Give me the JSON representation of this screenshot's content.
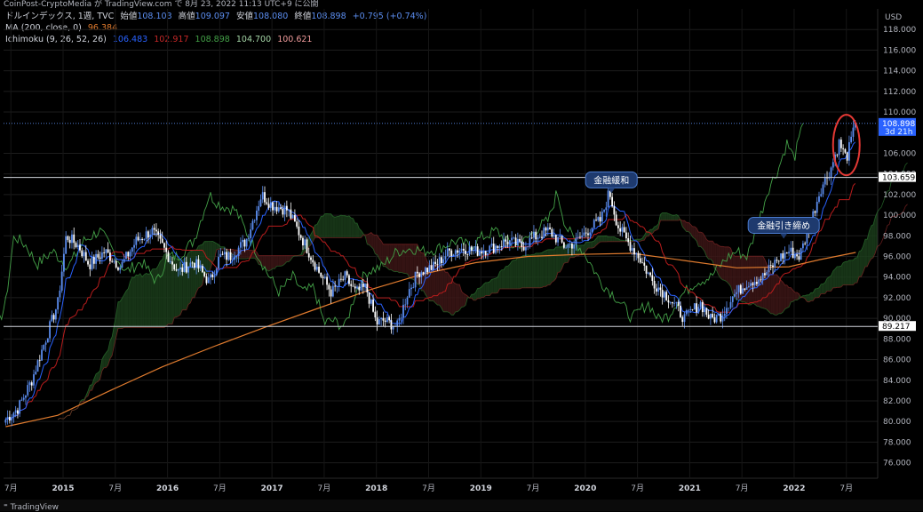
{
  "caption": "CoinPost-CryptoMedia が TradingView.com で 8月 23, 2022 11:13 UTC+9 に公開",
  "legend": {
    "line1": {
      "title": "ドルインデックス, 1週, TVC",
      "open_label": "始値",
      "open": "108.103",
      "high_label": "高値",
      "high": "109.097",
      "low_label": "安値",
      "low": "108.080",
      "close_label": "終値",
      "close": "108.898",
      "change": "+0.795 (+0.74%)"
    },
    "line2": {
      "label": "MA (200, close, 0)",
      "value": "96.384"
    },
    "line3": {
      "label": "Ichimoku (9, 26, 52, 26)",
      "v1": "106.483",
      "v2": "102.917",
      "v3": "108.898",
      "v4": "104.700",
      "v5": "100.621"
    }
  },
  "colors": {
    "candle_up": "#5b8def",
    "candle_down": "#ffffff",
    "conversion": "#2962ff",
    "base": "#b71c1c",
    "lagging": "#43a047",
    "ma200": "#e07b2e",
    "cloud_bull": "#1b3d1b",
    "cloud_bear": "#3d1616",
    "highlight": "#e53935"
  },
  "brand": "TradingView",
  "chart_data": {
    "type": "candlestick",
    "symbol": "ドルインデックス",
    "timeframe": "1週",
    "currency": "USD",
    "ylim": [
      74.5,
      120
    ],
    "y_ticks": [
      "118.000",
      "116.000",
      "114.000",
      "112.000",
      "110.000",
      "106.000",
      "104.000",
      "102.000",
      "100.000",
      "98.000",
      "96.000",
      "94.000",
      "92.000",
      "90.000",
      "88.000",
      "86.000",
      "84.000",
      "82.000",
      "80.000",
      "78.000",
      "76.000"
    ],
    "x_ticks": [
      "7月",
      "2015",
      "7月",
      "2016",
      "7月",
      "2017",
      "7月",
      "2018",
      "7月",
      "2019",
      "7月",
      "2020",
      "7月",
      "2021",
      "7月",
      "2022",
      "7月"
    ],
    "year_ticks": [
      "2015",
      "2016",
      "2017",
      "2018",
      "2019",
      "2020",
      "2021",
      "2022"
    ],
    "price_labels": [
      {
        "value": 108.898,
        "text": "108.898",
        "sub": "3d 21h",
        "kind": "last"
      },
      {
        "value": 103.659,
        "text": "103.659",
        "kind": "level"
      },
      {
        "value": 89.217,
        "text": "89.217",
        "kind": "level"
      }
    ],
    "horizontal_lines": [
      103.659,
      89.217
    ],
    "annotations": [
      {
        "text": "金融緩和",
        "date": 2020.3,
        "value": 102.3
      },
      {
        "text": "金融引き締め",
        "date": 2021.95,
        "value": 97.9
      }
    ],
    "highlight_ellipse": {
      "date": 2022.55,
      "value": 106.8
    },
    "price_path": {
      "t": [
        2014.5,
        2014.62,
        2014.75,
        2014.9,
        2015.0,
        2015.08,
        2015.2,
        2015.3,
        2015.45,
        2015.6,
        2015.75,
        2015.9,
        2016.0,
        2016.15,
        2016.3,
        2016.45,
        2016.55,
        2016.65,
        2016.8,
        2016.95,
        2017.05,
        2017.2,
        2017.35,
        2017.5,
        2017.62,
        2017.75,
        2017.85,
        2017.95,
        2018.05,
        2018.12,
        2018.25,
        2018.35,
        2018.45,
        2018.6,
        2018.75,
        2018.9,
        2019.0,
        2019.15,
        2019.3,
        2019.45,
        2019.55,
        2019.7,
        2019.85,
        2019.95,
        2020.1,
        2020.2,
        2020.28,
        2020.36,
        2020.45,
        2020.55,
        2020.7,
        2020.85,
        2021.0,
        2021.15,
        2021.25,
        2021.35,
        2021.45,
        2021.6,
        2021.75,
        2021.9,
        2022.0,
        2022.1,
        2022.2,
        2022.3,
        2022.4,
        2022.48,
        2022.55,
        2022.64
      ],
      "v": [
        80.2,
        81.3,
        84.0,
        88.5,
        91.5,
        98.0,
        97.0,
        95.2,
        96.5,
        95.0,
        97.5,
        98.5,
        97.0,
        94.5,
        95.5,
        93.5,
        96.0,
        96.0,
        97.5,
        102.0,
        101.0,
        100.5,
        97.5,
        94.5,
        92.5,
        94.0,
        92.5,
        93.0,
        89.5,
        89.8,
        89.2,
        92.5,
        94.5,
        95.0,
        96.5,
        96.8,
        96.5,
        96.8,
        97.5,
        97.0,
        97.8,
        98.5,
        97.0,
        97.3,
        98.8,
        99.5,
        102.3,
        99.0,
        97.5,
        96.2,
        93.5,
        92.0,
        90.0,
        91.5,
        89.9,
        90.3,
        92.0,
        93.5,
        94.0,
        95.8,
        96.5,
        96.0,
        99.0,
        102.5,
        104.5,
        107.0,
        105.5,
        108.898
      ]
    },
    "ma200_path": {
      "t": [
        2014.5,
        2015.0,
        2015.5,
        2016.0,
        2016.5,
        2017.0,
        2017.5,
        2018.0,
        2018.5,
        2019.0,
        2019.5,
        2020.0,
        2020.5,
        2021.0,
        2021.5,
        2022.0,
        2022.3,
        2022.64
      ],
      "v": [
        79.5,
        80.6,
        83.0,
        85.3,
        87.3,
        89.2,
        91.0,
        92.8,
        94.3,
        95.4,
        96.0,
        96.2,
        96.3,
        95.6,
        94.9,
        95.0,
        95.7,
        96.384
      ]
    }
  }
}
